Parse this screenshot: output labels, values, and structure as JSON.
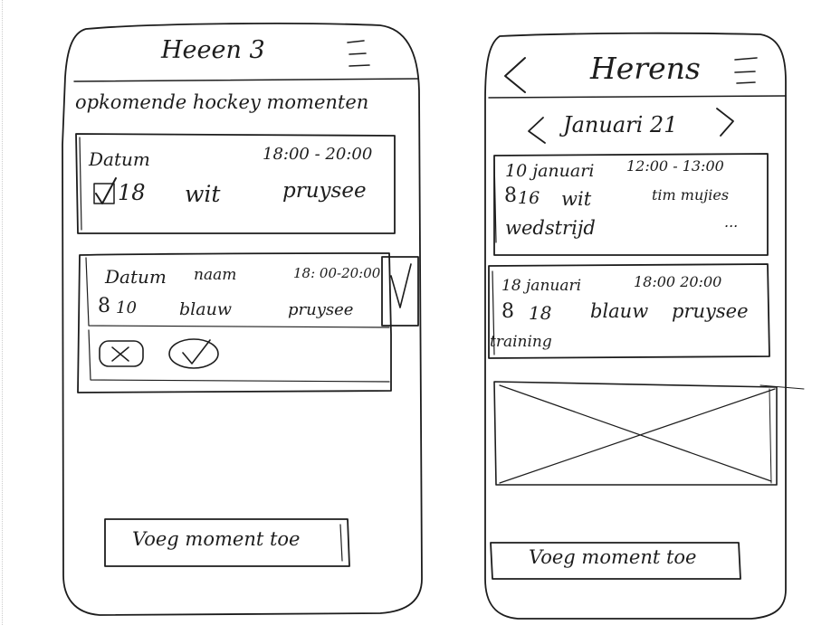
{
  "left_screen": {
    "header": {
      "title": "Heeen 3",
      "menu_icon": "hamburger-menu-icon"
    },
    "section_title": "opkomende hockey momenten",
    "card1": {
      "date": "Datum",
      "time": "18:00 - 20:00",
      "checkbox_icon": "checked-box-icon",
      "team": "18",
      "color": "wit",
      "location": "pruysee"
    },
    "card2": {
      "date": "Datum",
      "name": "naam",
      "time": "18: 00-20:00",
      "person_icon": "person-icon",
      "team": "10",
      "color": "blauw",
      "location": "pruysee",
      "confirm_icon": "check-icon",
      "decline_icon": "cross-icon",
      "accept_icon": "check-icon"
    },
    "add_button": "Voeg moment toe"
  },
  "right_screen": {
    "header": {
      "back_icon": "back-arrow-icon",
      "title": "Herens",
      "menu_icon": "hamburger-menu-icon"
    },
    "month_nav": {
      "prev_icon": "chevron-left-icon",
      "label": "Januari 21",
      "next_icon": "chevron-right-icon"
    },
    "card1": {
      "date": "10 januari",
      "time": "12:00 - 13:00",
      "person_icon": "person-icon",
      "team": "16",
      "color": "wit",
      "name": "tim mujies",
      "kind": "wedstrijd",
      "more": "..."
    },
    "card2": {
      "date": "18 januari",
      "time": "18:00 20:00",
      "person_icon": "person-icon",
      "team": "18",
      "color": "blauw",
      "location": "pruysee",
      "kind": "training"
    },
    "placeholder_icon": "image-placeholder-icon",
    "add_button": "Voeg moment toe"
  }
}
